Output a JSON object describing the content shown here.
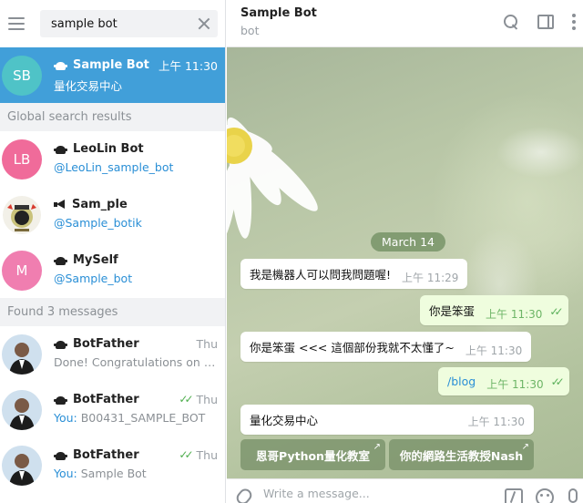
{
  "search": {
    "value": "sample bot"
  },
  "chats": {
    "active": {
      "initials": "SB",
      "name": "Sample Bot",
      "time": "上午 11:30",
      "preview": "量化交易中心",
      "avatar_color": "#4fc3c7"
    }
  },
  "sections": {
    "global": "Global search results",
    "found": "Found 3 messages"
  },
  "global_results": [
    {
      "initials": "LB",
      "name": "LeoLin Bot",
      "handle": "@LeoLin_sample_bot",
      "avatar_color": "#f06b9a",
      "icon": "bot-icon"
    },
    {
      "initials": "",
      "name": "Sam_ple",
      "handle": "@Sample_botik",
      "avatar_color": "#ffffff",
      "icon": "channel-icon"
    },
    {
      "initials": "M",
      "name": "MySelf",
      "handle": "@Sample_bot",
      "avatar_color": "#f07eb0",
      "icon": "bot-icon"
    }
  ],
  "found_messages": [
    {
      "name": "BotFather",
      "time": "Thu",
      "preview": "Done! Congratulations on yo...",
      "you": "",
      "read": false
    },
    {
      "name": "BotFather",
      "time": "Thu",
      "preview": "B00431_SAMPLE_BOT",
      "you": "You: ",
      "read": true
    },
    {
      "name": "BotFather",
      "time": "Thu",
      "preview": "Sample Bot",
      "you": "You: ",
      "read": true
    }
  ],
  "header": {
    "title": "Sample Bot",
    "subtitle": "bot"
  },
  "messages": {
    "date": "March 14",
    "m1": {
      "text": "我是機器人可以問我問題喔!",
      "time": "上午 11:29"
    },
    "m2": {
      "text": "你是笨蛋",
      "time": "上午 11:30"
    },
    "m3": {
      "text": "你是笨蛋 <<< 這個部份我就不太懂了~",
      "time": "上午 11:30"
    },
    "m4": {
      "text": "/blog",
      "time": "上午 11:30"
    },
    "m5": {
      "text": "量化交易中心",
      "time": "上午 11:30"
    }
  },
  "inline_buttons": [
    "恩哥Python量化教室",
    "你的網路生活教授Nash"
  ],
  "composer": {
    "placeholder": "Write a message..."
  }
}
